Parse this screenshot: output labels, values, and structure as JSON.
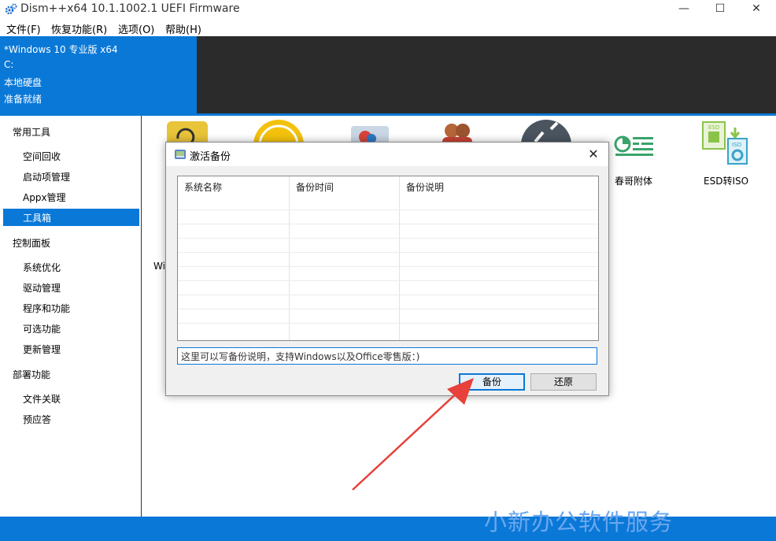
{
  "window": {
    "title": "Dism++x64 10.1.1002.1 UEFI Firmware",
    "minimize_glyph": "—",
    "maximize_glyph": "☐",
    "close_glyph": "✕"
  },
  "menu": [
    "文件(F)",
    "恢复功能(R)",
    "选项(O)",
    "帮助(H)"
  ],
  "header": {
    "os": "*Windows 10 专业版 x64",
    "drive": "C:",
    "disk": "本地硬盘",
    "status": "准备就绪"
  },
  "sidebar": {
    "cat_common": "常用工具",
    "common": [
      "空间回收",
      "启动项管理",
      "Appx管理",
      "工具箱"
    ],
    "cat_control": "控制面板",
    "control": [
      "系统优化",
      "驱动管理",
      "程序和功能",
      "可选功能",
      "更新管理"
    ],
    "cat_deploy": "部署功能",
    "deploy": [
      "文件关联",
      "预应答"
    ],
    "selected": "工具箱"
  },
  "tools": {
    "chunge_label": "春哥附体",
    "esd_label": "ESD转ISO",
    "partial_label": "Wi",
    "esd_icon_text": "ESD",
    "iso_icon_text": "ISO"
  },
  "dialog": {
    "title": "激活备份",
    "close_glyph": "✕",
    "columns": [
      "系统名称",
      "备份时间",
      "备份说明"
    ],
    "description_value": "这里可以写备份说明，支持Windows以及Office零售版：)",
    "backup_button": "备份",
    "restore_button": "还原"
  },
  "watermark": "小新办公软件服务",
  "colors": {
    "accent": "#0a78d7",
    "header_dark": "#2b2b2b",
    "arrow": "#e8403a",
    "icon_green": "#3aa36b"
  }
}
